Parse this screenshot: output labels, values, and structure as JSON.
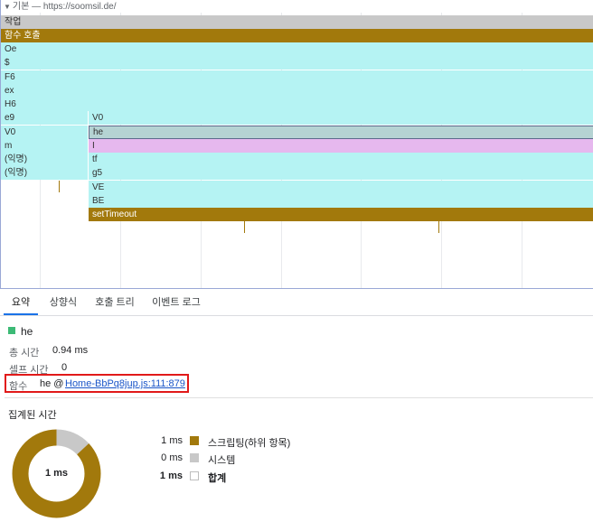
{
  "track": {
    "arrow": "▼",
    "title": "기본 — https://soomsil.de/"
  },
  "flame": {
    "task_label": "작업",
    "function_call_label": "함수 호출",
    "left_column": [
      "Oe",
      "$",
      "F6",
      "ex",
      "H6",
      "e9",
      "V0",
      "m",
      "(익명)",
      "(익명)"
    ],
    "right_column": [
      "V0",
      "he",
      "I",
      "tf",
      "g5",
      "VE",
      "BE"
    ],
    "timeout_label": "setTimeout"
  },
  "tabs": [
    "요약",
    "상향식",
    "호출 트리",
    "이벤트 로그"
  ],
  "summary": {
    "selected_name": "he",
    "total_time_label": "총 시간",
    "total_time_value": "0.94 ms",
    "self_time_label": "셀프 시간",
    "self_time_value": "0",
    "function_label": "함수",
    "function_name": "he @",
    "function_link": "Home-BbPq8jup.js:111:879"
  },
  "aggregated": {
    "title": "집계된 시간",
    "center_label": "1 ms",
    "rows": [
      {
        "value": "1 ms",
        "label": "스크립팅(하위 항목)",
        "color": "#a2790c"
      },
      {
        "value": "0 ms",
        "label": "시스템",
        "color": "#c8c8c8"
      },
      {
        "value": "1 ms",
        "label": "합계",
        "color": "#ffffff"
      }
    ],
    "donut": {
      "scripting_fraction": 0.87,
      "system_fraction": 0.13
    }
  },
  "colors": {
    "function_bar": "#b5f3f3",
    "scripting": "#a2790c",
    "system": "#c8c8c8",
    "selection_outline": "#e11919",
    "accent": "#1a73e8"
  }
}
